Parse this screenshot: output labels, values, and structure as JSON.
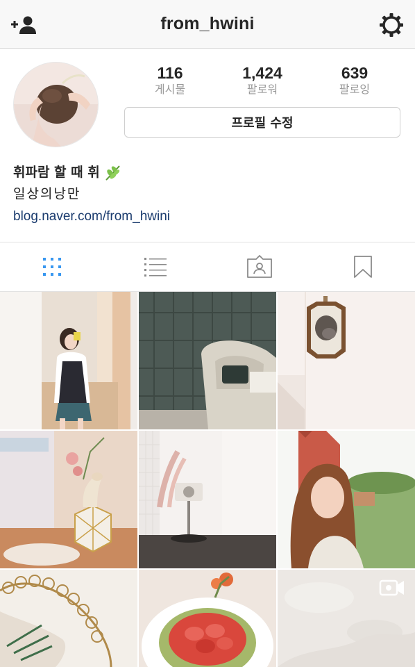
{
  "header": {
    "username": "from_hwini",
    "left_icon": "add-user-icon",
    "right_icon": "gear-icon"
  },
  "profile": {
    "posts_count": "116",
    "posts_label": "게시물",
    "followers_count": "1,424",
    "followers_label": "팔로워",
    "following_count": "639",
    "following_label": "팔로잉",
    "edit_button_label": "프로필 수정",
    "display_name": "휘파람 할 때 휘",
    "bio_line": "일상의낭만",
    "link": "blog.naver.com/from_hwini"
  },
  "tabs": [
    {
      "name": "grid",
      "icon": "grid-icon",
      "active": true
    },
    {
      "name": "list",
      "icon": "list-icon",
      "active": false
    },
    {
      "name": "tagged",
      "icon": "tagged-icon",
      "active": false
    },
    {
      "name": "saved",
      "icon": "bookmark-icon",
      "active": false
    }
  ],
  "colors": {
    "accent": "#3897f0",
    "link": "#1a3b6e",
    "muted": "#999999"
  }
}
